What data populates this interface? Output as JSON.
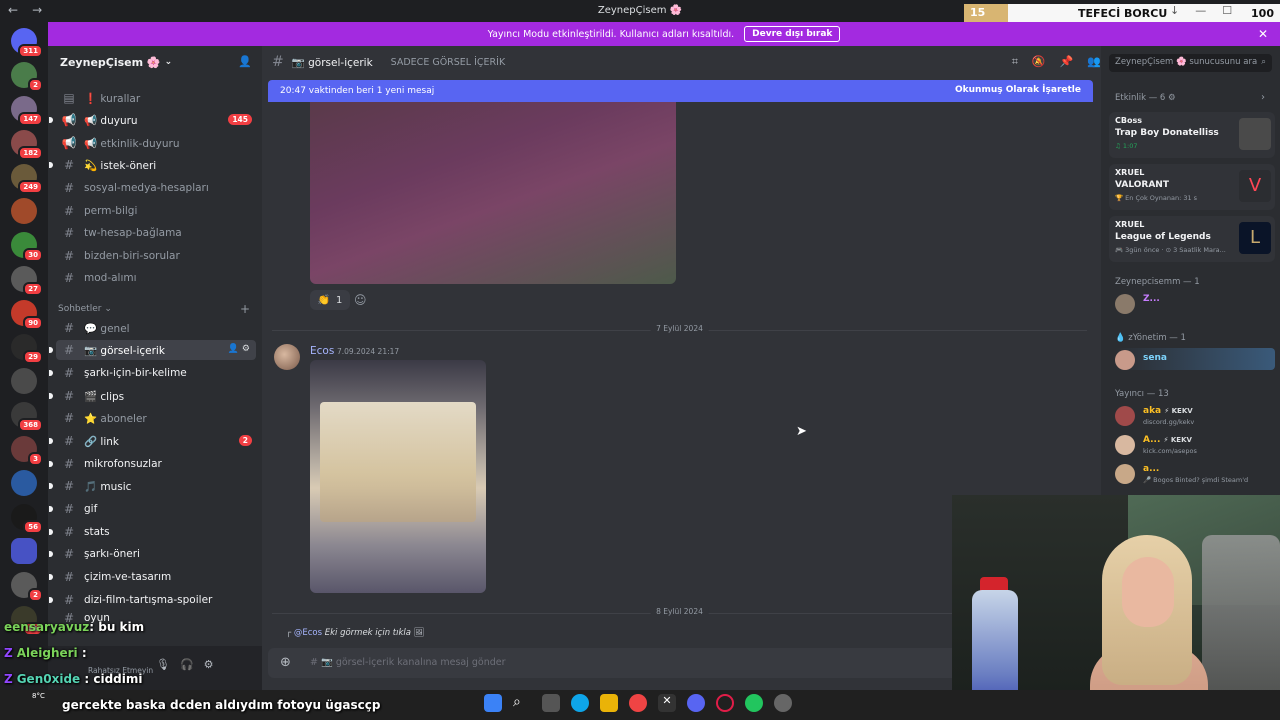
{
  "titlebar": {
    "title": "ZeynepÇisem 🌸",
    "tefeci": {
      "count": "15",
      "label": "TEFECİ BORCU",
      "value": "100"
    }
  },
  "banner": {
    "text": "Yayıncı Modu etkinleştirildi. Kullanıcı adları kısaltıldı.",
    "button": "Devre dışı bırak"
  },
  "servers": {
    "badges": [
      "311",
      "2",
      "147",
      "182",
      "249",
      "30",
      "27",
      "90",
      "29",
      "368",
      "3",
      "56",
      "2",
      "81"
    ]
  },
  "sidebar": {
    "guild_name": "ZeynepÇisem 🌸",
    "channels": [
      {
        "label": "❗ kurallar"
      },
      {
        "label": "📢 duyuru",
        "badge": "145"
      },
      {
        "label": "📢 etkinlik-duyuru"
      },
      {
        "label": "💫 istek-öneri"
      },
      {
        "label": "sosyal-medya-hesapları"
      },
      {
        "label": "perm-bilgi"
      },
      {
        "label": "tw-hesap-bağlama"
      },
      {
        "label": "bizden-biri-sorular"
      },
      {
        "label": "mod-alımı"
      }
    ],
    "category": "Sohbetler",
    "chat_channels": [
      {
        "label": "💬 genel"
      },
      {
        "label": "📷 görsel-içerik"
      },
      {
        "label": "şarkı-için-bir-kelime"
      },
      {
        "label": "🎬 clips"
      },
      {
        "label": "⭐ aboneler"
      },
      {
        "label": "🔗 link",
        "badge": "2"
      },
      {
        "label": "mikrofonsuzlar"
      },
      {
        "label": "🎵 music"
      },
      {
        "label": "gif"
      },
      {
        "label": "stats"
      },
      {
        "label": "şarkı-öneri"
      },
      {
        "label": "çizim-ve-tasarım"
      },
      {
        "label": "dizi-film-tartışma-spoiler"
      },
      {
        "label": "oyun"
      }
    ],
    "user_status": "Rahatsız Etmeyin"
  },
  "main": {
    "channel_name": "📷 görsel-içerik",
    "topic": "SADECE GÖRSEL İÇERİK",
    "new_messages": "20:47 vaktinden beri 1 yeni mesaj",
    "mark_read": "Okunmuş Olarak İşaretle",
    "reaction_count": "1",
    "date1": "7 Eylül 2024",
    "author": "Ecos",
    "timestamp": "7.09.2024 21:17",
    "date2": "8 Eylül 2024",
    "reply_mention": "@Ecos",
    "reply_text": "Eki görmek için tıkla",
    "composer_placeholder": "# 📷 görsel-içerik kanalına mesaj gönder"
  },
  "right_panel": {
    "search_placeholder": "ZeynepÇisem 🌸 sunucusunu ara",
    "activity_header": "Etkinlik — 6",
    "cards": [
      {
        "who": "CBoss",
        "game": "Trap Boy Donatelliss",
        "meta": "♫ 1:07",
        "art": "#3d3d3d"
      },
      {
        "who": "XRUEL",
        "game": "VALORANT",
        "meta": "🏆 En Çok Oynanan: 31 s",
        "art": "#ff4655"
      },
      {
        "who": "XRUEL",
        "game": "League of Legends",
        "meta": "🎮 3gün önce · ⊙ 3 Saatlik Mara...",
        "art": "#c8aa6e"
      }
    ],
    "groups": [
      {
        "header": "Zeynepcisemm — 1",
        "members": [
          {
            "name": "Z...",
            "sub": "",
            "color": "#c77dff"
          }
        ]
      },
      {
        "header": "💧 zYönetim — 1",
        "members": [
          {
            "name": "sena",
            "sub": "",
            "color": "#7dd3fc"
          }
        ]
      },
      {
        "header": "Yayıncı — 13",
        "members": [
          {
            "name": "aka",
            "tag": "⚡ KEKV",
            "sub": "discord.gg/kekv",
            "color": "#fbbf24"
          },
          {
            "name": "A...",
            "tag": "⚡ KEKV",
            "sub": "kick.com/asepos",
            "color": "#fbbf24"
          },
          {
            "name": "a...",
            "sub": "🎤 Bogos Binted? şimdi Steam'd",
            "color": "#fbbf24"
          }
        ]
      }
    ]
  },
  "stream_chat": [
    {
      "user": "eensaryavuz",
      "text": ": bu kim"
    },
    {
      "user": "Aleigheri",
      "text": ":"
    },
    {
      "user": "Gen0xide",
      "text": ": ciddimi"
    },
    {
      "user": "",
      "text": "gercekte baska dcden aldıydım fotoyu ügascçp"
    }
  ],
  "taskbar": {
    "weather": "8°C"
  }
}
